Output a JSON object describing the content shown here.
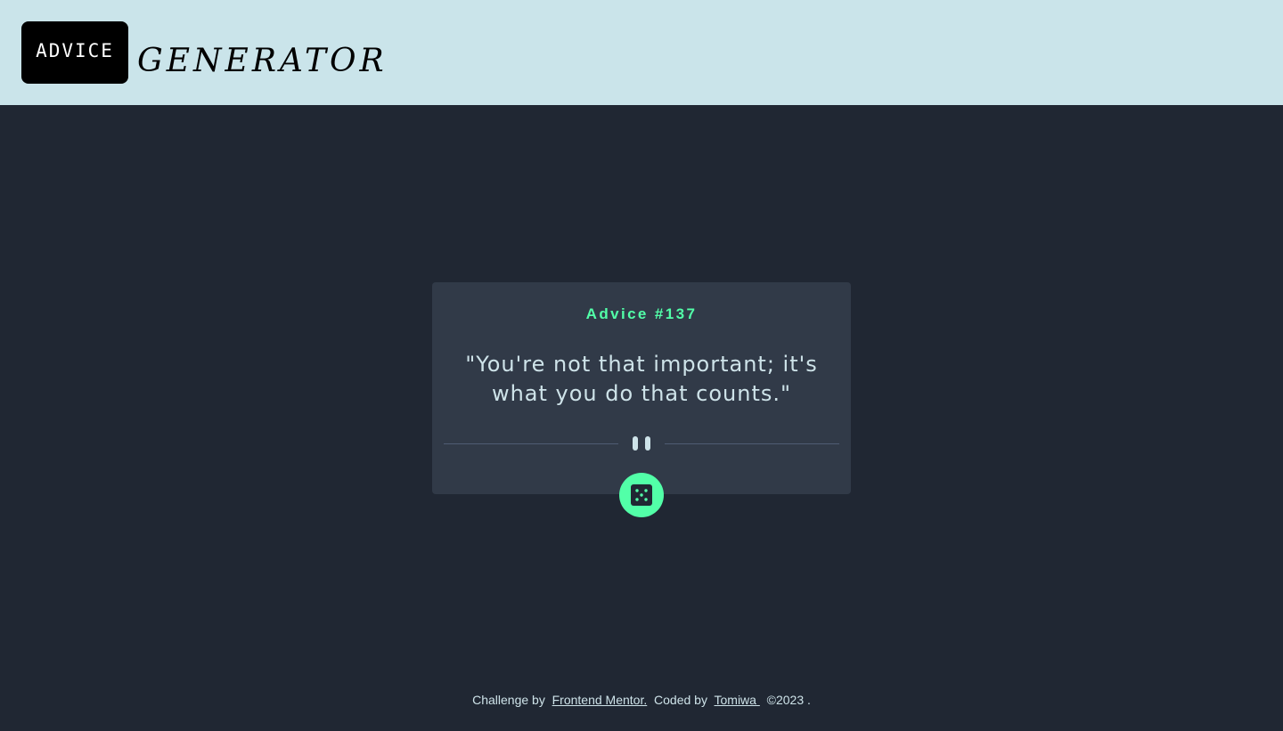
{
  "header": {
    "logo_text": "ADVICE",
    "title": "GENERATOR"
  },
  "card": {
    "advice_label": "Advice  #137",
    "quote": "\"You're not that important; it's what you do that counts.\""
  },
  "icons": {
    "pause": "pause-icon",
    "dice": "dice-icon"
  },
  "footer": {
    "challenge_prefix": "Challenge by  ",
    "challenge_link": "Frontend Mentor.",
    "coded_prefix": "  Coded by  ",
    "author_link": "Tomiwa ",
    "copyright": "  ©2023 ."
  },
  "colors": {
    "header_bg": "#cae4ea",
    "page_bg": "#202733",
    "card_bg": "#313a48",
    "accent": "#52ffa8",
    "text_light": "#cee3e9"
  }
}
